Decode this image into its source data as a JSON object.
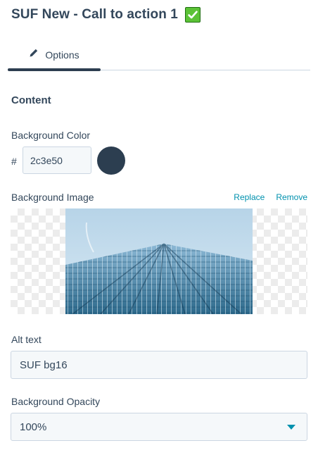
{
  "header": {
    "title": "SUF New - Call to action 1"
  },
  "tabs": [
    {
      "label": "Options",
      "icon": "pencil-icon",
      "active": true
    }
  ],
  "content": {
    "section_title": "Content"
  },
  "background_color": {
    "label": "Background Color",
    "hash": "#",
    "value": "2c3e50",
    "swatch_color": "#2c3e50"
  },
  "background_image": {
    "label": "Background Image",
    "replace_label": "Replace",
    "remove_label": "Remove"
  },
  "alt_text": {
    "label": "Alt text",
    "value": "SUF bg16"
  },
  "background_opacity": {
    "label": "Background Opacity",
    "value": "100%"
  },
  "colors": {
    "text": "#33475b",
    "link": "#0091ae",
    "accent": "#2d3e50",
    "input_bg": "#f5f8fa",
    "border": "#cbd6e2"
  }
}
